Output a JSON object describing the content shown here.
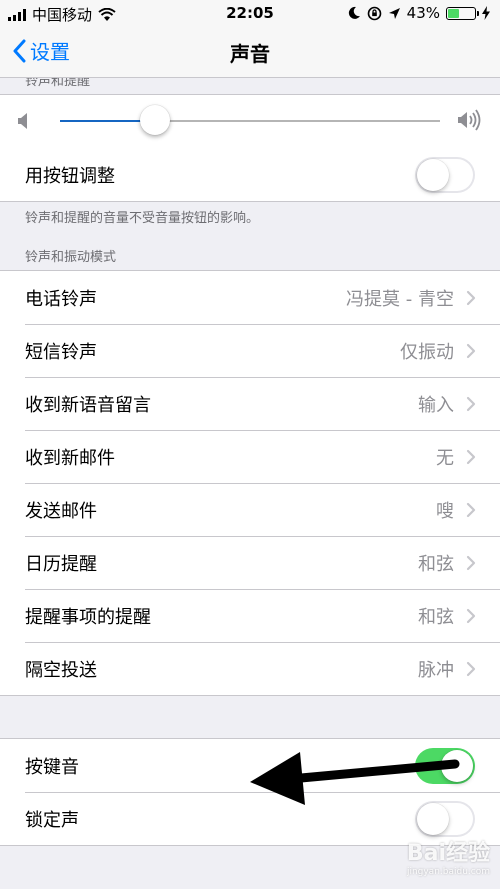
{
  "status": {
    "carrier": "中国移动",
    "time": "22:05",
    "battery": "43%",
    "battery_level": 0.43,
    "icons": [
      "signal-icon",
      "wifi-icon",
      "moon-icon",
      "orientation-lock-icon",
      "location-icon",
      "battery-icon",
      "charging-icon"
    ]
  },
  "nav": {
    "back_label": "设置",
    "title": "声音"
  },
  "ringer": {
    "header_partial": "铃声和提醒",
    "volume_level": 0.25,
    "change_with_buttons_label": "用按钮调整",
    "change_with_buttons_on": false,
    "footer": "铃声和提醒的音量不受音量按钮的影响。"
  },
  "patterns": {
    "header": "铃声和振动模式",
    "items": [
      {
        "label": "电话铃声",
        "value": "冯提莫 - 青空"
      },
      {
        "label": "短信铃声",
        "value": "仅振动"
      },
      {
        "label": "收到新语音留言",
        "value": "输入"
      },
      {
        "label": "收到新邮件",
        "value": "无"
      },
      {
        "label": "发送邮件",
        "value": "嗖"
      },
      {
        "label": "日历提醒",
        "value": "和弦"
      },
      {
        "label": "提醒事项的提醒",
        "value": "和弦"
      },
      {
        "label": "隔空投送",
        "value": "脉冲"
      }
    ]
  },
  "system": {
    "keyboard_clicks_label": "按键音",
    "keyboard_clicks_on": true,
    "lock_sound_label": "锁定声",
    "lock_sound_on": false
  },
  "colors": {
    "accent": "#007aff",
    "switch_on": "#4cd964",
    "slider_fill": "#1566c2"
  },
  "watermark": {
    "brand": "Bai经验",
    "url": "jingyan.baidu.com"
  }
}
